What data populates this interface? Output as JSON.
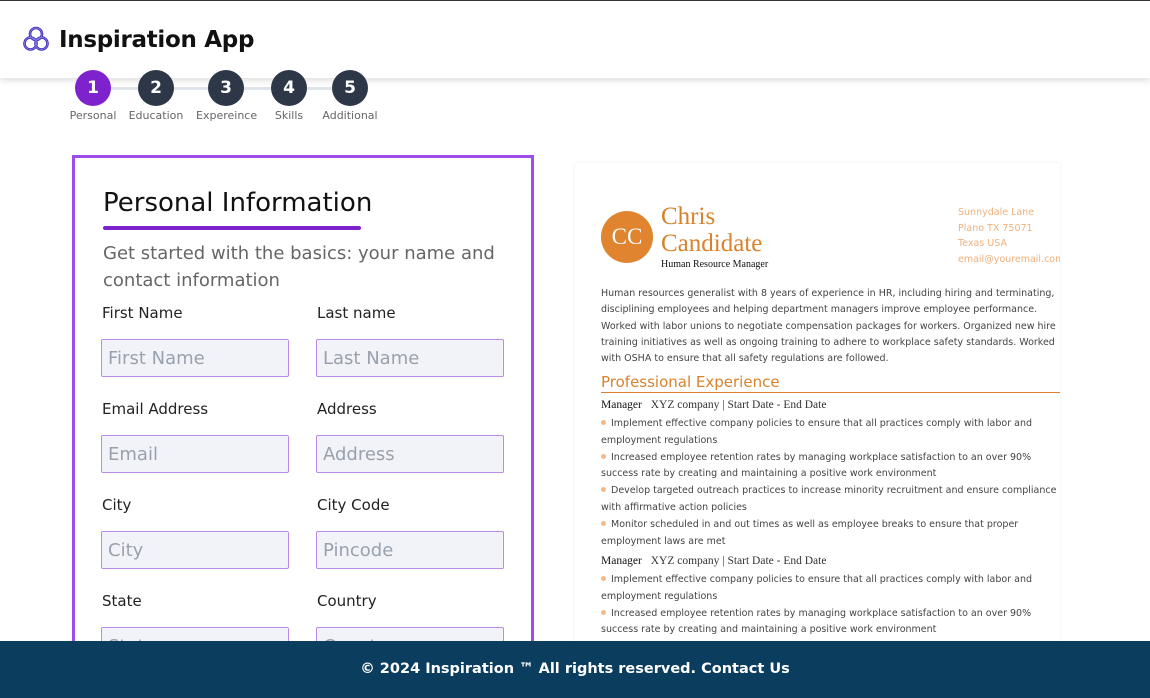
{
  "header": {
    "logo_icon": "triquetra-knot-icon",
    "logo_color": "#3b2bb8",
    "title": "Inspiration App"
  },
  "stepper": {
    "active_color": "#7e22ce",
    "inactive_color": "#2d3748",
    "steps": [
      {
        "number": "1",
        "label": "Personal",
        "active": true
      },
      {
        "number": "2",
        "label": "Education",
        "active": false
      },
      {
        "number": "3",
        "label": "Expereince",
        "active": false
      },
      {
        "number": "4",
        "label": "Skills",
        "active": false
      },
      {
        "number": "5",
        "label": "Additional",
        "active": false
      }
    ]
  },
  "form": {
    "title": "Personal Information",
    "subtitle": "Get started with the basics: your name and contact information",
    "accent": "#9b4de8",
    "fields": {
      "first_name": {
        "label": "First Name",
        "placeholder": "First Name",
        "value": ""
      },
      "last_name": {
        "label": "Last name",
        "placeholder": "Last Name",
        "value": ""
      },
      "email": {
        "label": "Email Address",
        "placeholder": "Email",
        "value": ""
      },
      "address": {
        "label": "Address",
        "placeholder": "Address",
        "value": ""
      },
      "city": {
        "label": "City",
        "placeholder": "City",
        "value": ""
      },
      "city_code": {
        "label": "City Code",
        "placeholder": "Pincode",
        "value": ""
      },
      "state": {
        "label": "State",
        "placeholder": "State",
        "value": ""
      },
      "country": {
        "label": "Country",
        "placeholder": "Country",
        "value": ""
      }
    }
  },
  "resume": {
    "accent": "#d9822b",
    "initials": "CC",
    "name": "Chris Candidate",
    "role": "Human Resource Manager",
    "address": {
      "street": "Sunnydale Lane",
      "city_line": "Plano TX 75071",
      "country": "Texas USA",
      "email": "email@youremail.com"
    },
    "summary": "Human resources generalist with 8 years of experience in HR, including hiring and terminating, disciplining employees and helping department managers improve employee performance. Worked with labor unions to negotiate compensation packages for workers. Organized new hire training initiatives as well as ongoing training to adhere to workplace safety standards. Worked with OSHA to ensure that all safety regulations are followed.",
    "section_title": "Professional Experience",
    "jobs": [
      {
        "title": "Manager",
        "company": "XYZ company | Start Date - End Date",
        "bullets": [
          "Implement effective company policies to ensure that all practices comply with labor and employment regulations",
          "Increased employee retention rates by managing workplace satisfaction to an over 90% success rate by creating and maintaining a positive work environment",
          "Develop targeted outreach practices to increase minority recruitment and ensure compliance with affirmative action policies",
          "Monitor scheduled in and out times as well as employee breaks to ensure that proper employment laws are met"
        ]
      },
      {
        "title": "Manager",
        "company": "XYZ company | Start Date - End Date",
        "bullets": [
          "Implement effective company policies to ensure that all practices comply with labor and employment regulations",
          "Increased employee retention rates by managing workplace satisfaction to an over 90% success rate by creating and maintaining a positive work environment"
        ]
      }
    ]
  },
  "footer": {
    "copyright": "© 2024 Inspiration ™ All rights reserved.",
    "contact_link": "Contact Us",
    "background": "#0b3e5e"
  }
}
